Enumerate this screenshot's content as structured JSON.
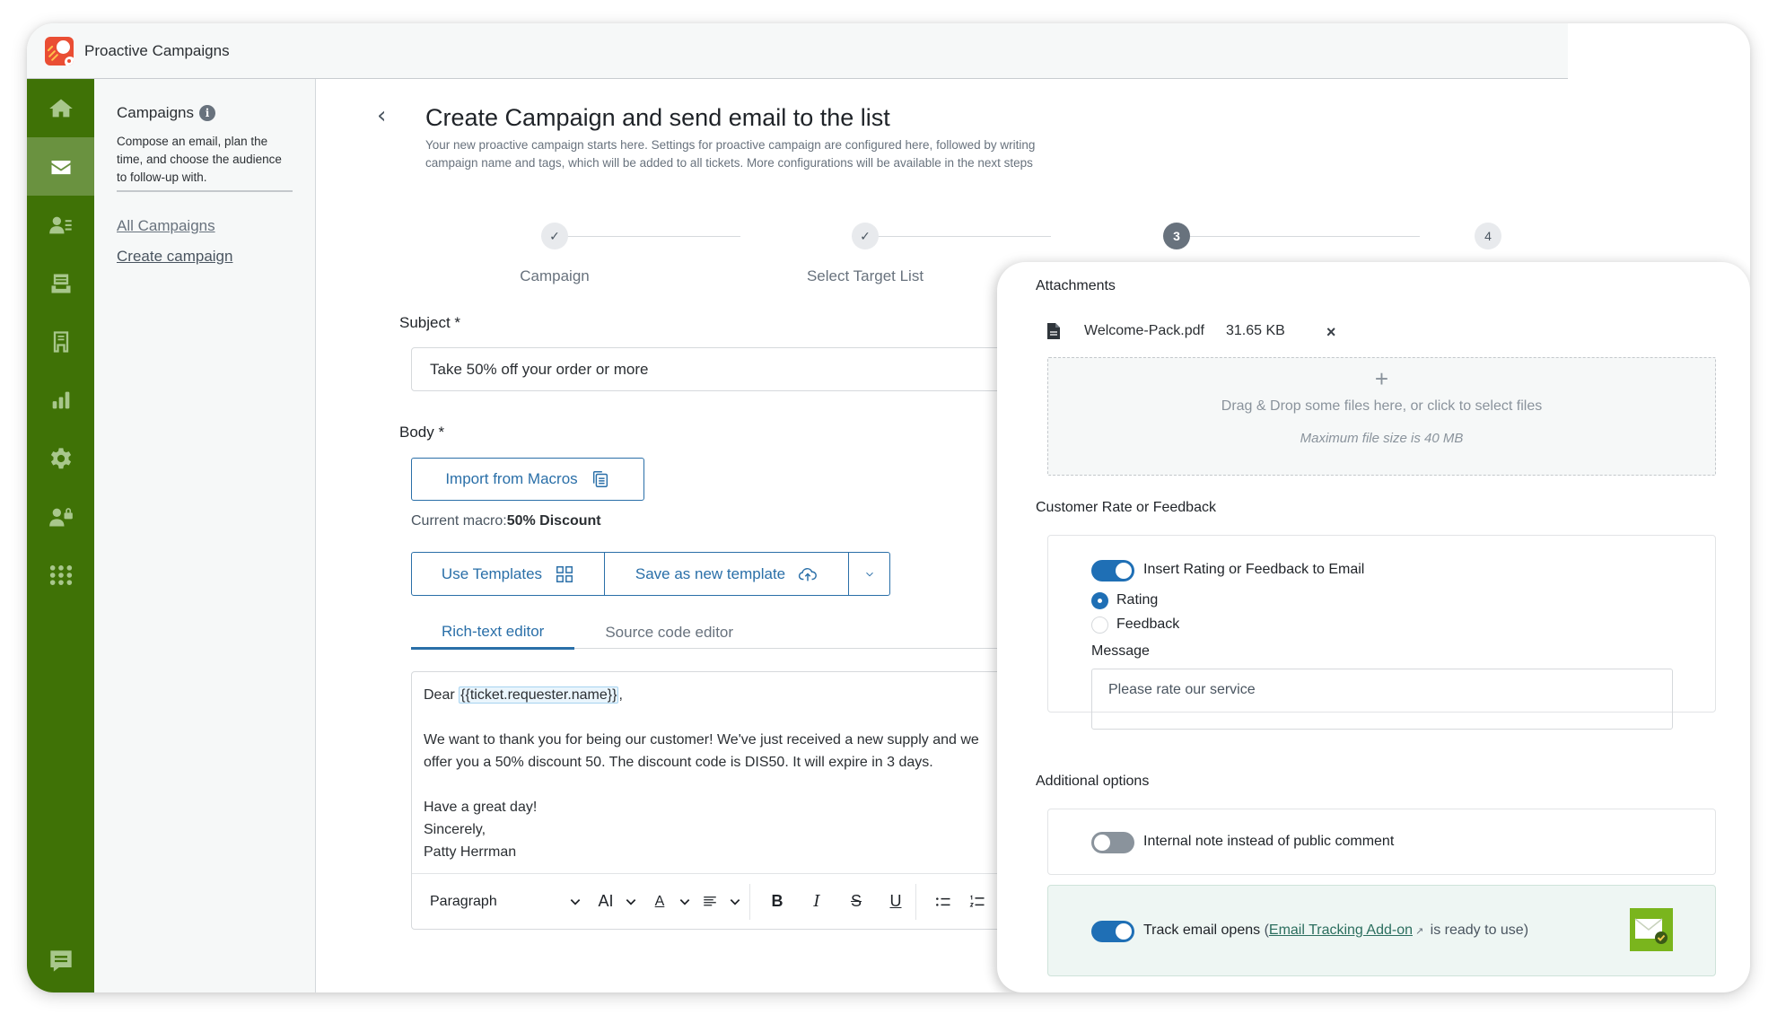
{
  "app": {
    "title": "Proactive Campaigns",
    "logo_icon": "rocket-ball-logo",
    "brand_color": "#3f7206",
    "accent_color": "#2a6fa8"
  },
  "nav_rail": {
    "items": [
      {
        "name": "home",
        "icon": "home-icon",
        "active": false
      },
      {
        "name": "campaigns",
        "icon": "mail-icon",
        "active": true
      },
      {
        "name": "contacts",
        "icon": "user-list-icon",
        "active": false
      },
      {
        "name": "inbox",
        "icon": "inbox-tray-icon",
        "active": false
      },
      {
        "name": "reports",
        "icon": "document-icon",
        "active": false
      },
      {
        "name": "analytics",
        "icon": "bar-chart-icon",
        "active": false
      },
      {
        "name": "settings",
        "icon": "gear-icon",
        "active": false
      },
      {
        "name": "user-permissions",
        "icon": "user-lock-icon",
        "active": false
      },
      {
        "name": "apps",
        "icon": "grid-dots-icon",
        "active": false
      }
    ],
    "bottom_item": {
      "name": "feedback",
      "icon": "chat-icon"
    }
  },
  "sub_nav": {
    "title": "Campaigns",
    "description": "Compose an email, plan the time, and choose the audience to follow-up with.",
    "links": [
      {
        "label": "All Campaigns",
        "current": false
      },
      {
        "label": "Create campaign",
        "current": true
      }
    ]
  },
  "page": {
    "title": "Create Campaign and send email to the list",
    "description": "Your new proactive campaign starts here. Settings for proactive campaign are configured here, followed by writing campaign name and tags, which will be added to all tickets. More configurations will be available in the next steps"
  },
  "stepper": {
    "steps": [
      {
        "number": "1",
        "label": "Campaign",
        "status": "done",
        "glyph": "✓"
      },
      {
        "number": "2",
        "label": "Select Target List",
        "status": "done",
        "glyph": "✓"
      },
      {
        "number": "3",
        "label": "",
        "status": "current",
        "glyph": "3"
      },
      {
        "number": "4",
        "label": "",
        "status": "pending",
        "glyph": "4"
      }
    ]
  },
  "form": {
    "subject_label": "Subject *",
    "subject_value": "Take 50% off your order or more",
    "body_label": "Body *",
    "import_macros_label": "Import from Macros",
    "current_macro_prefix": "Current macro:",
    "current_macro_value": "50% Discount",
    "use_templates_label": "Use Templates",
    "save_template_label": "Save as new template",
    "tabs": [
      {
        "label": "Rich-text editor",
        "active": true
      },
      {
        "label": "Source code editor",
        "active": false
      }
    ],
    "editor": {
      "greeting_prefix": "Dear ",
      "placeholder_token": "{{ticket.requester.name}}",
      "greeting_suffix": ",",
      "paragraph_line1": "We want to thank you for being our customer! We've just received a new supply and we",
      "paragraph_line2": "offer you a 50% discount 50. The discount code is DIS50. It will expire in 3 days.",
      "closing1": "Have a great day!",
      "closing2": "Sincerely,",
      "signature": "Patty Herrman"
    },
    "toolbar": {
      "block_format": "Paragraph",
      "font_size_label": "AI",
      "font_color_label": "A",
      "bold": "B",
      "italic": "I",
      "strike": "S",
      "underline": "U"
    }
  },
  "panel": {
    "attachments_heading": "Attachments",
    "attachment": {
      "filename": "Welcome-Pack.pdf",
      "size": "31.65 KB",
      "remove_glyph": "×"
    },
    "dropzone_plus": "+",
    "dropzone_text": "Drag & Drop some files here, or click to select files",
    "dropzone_limit": "Maximum file size is 40 MB",
    "feedback_heading": "Customer Rate or Feedback",
    "insert_toggle_label": "Insert Rating or Feedback to Email",
    "insert_toggle_on": true,
    "radio_options": [
      {
        "label": "Rating",
        "checked": true
      },
      {
        "label": "Feedback",
        "checked": false
      }
    ],
    "message_label": "Message",
    "message_value": "Please rate our service",
    "additional_heading": "Additional options",
    "internal_note_label": "Internal note instead of public comment",
    "internal_note_on": false,
    "track_label": "Track email opens",
    "track_on": true,
    "track_open_paren": " (",
    "track_link": "Email Tracking Add-on",
    "track_suffix": " is ready to use)",
    "addon_icon": "email-tracking-addon-icon"
  }
}
